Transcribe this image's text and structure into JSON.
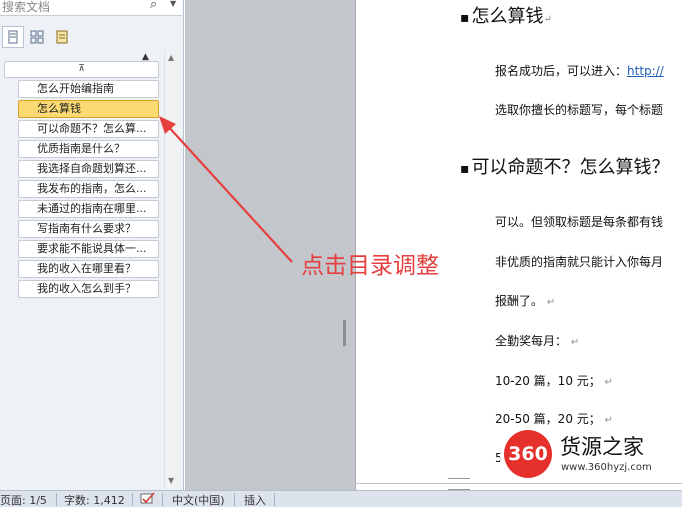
{
  "nav_pane": {
    "search_placeholder": "搜索文档",
    "search_icon": "magnifier-icon",
    "headings": [
      {
        "label": "怎么开始编指南",
        "selected": false
      },
      {
        "label": "怎么算钱",
        "selected": true
      },
      {
        "label": "可以命题不？怎么算...",
        "selected": false
      },
      {
        "label": "优质指南是什么？",
        "selected": false
      },
      {
        "label": "我选择自命题划算还...",
        "selected": false
      },
      {
        "label": "我发布的指南，怎么...",
        "selected": false
      },
      {
        "label": "未通过的指南在哪里...",
        "selected": false
      },
      {
        "label": "写指南有什么要求？",
        "selected": false
      },
      {
        "label": "要求能不能说具体一...",
        "selected": false
      },
      {
        "label": "我的收入在哪里看？",
        "selected": false
      },
      {
        "label": "我的收入怎么到手？",
        "selected": false
      }
    ],
    "selection_color": "#fbd973"
  },
  "document": {
    "heading1": "怎么算钱",
    "line1_text": "报名成功后，可以进入：",
    "line1_link": "http://",
    "line2": "选取你擅长的标题写，每个标题",
    "heading2": "可以命题不？怎么算钱？",
    "line3": "可以。但领取标题是每条都有钱",
    "line4": "非优质的指南就只能计入你每月",
    "line5": "报酬了。",
    "line6": "全勤奖每月：",
    "line7": "10-20 篇，10 元；",
    "line8": "20-50 篇，20 元；",
    "line9": "5",
    "return_mark": "↵"
  },
  "annotation": {
    "text": "点击目录调整",
    "color": "#e5403f"
  },
  "watermark": {
    "badge": "360",
    "title": "货源之家",
    "url": "www.360hyzj.com"
  },
  "status_bar": {
    "page": "页面: 1/5",
    "words": "字数: 1,412",
    "language": "中文(中国)",
    "mode": "插入"
  }
}
